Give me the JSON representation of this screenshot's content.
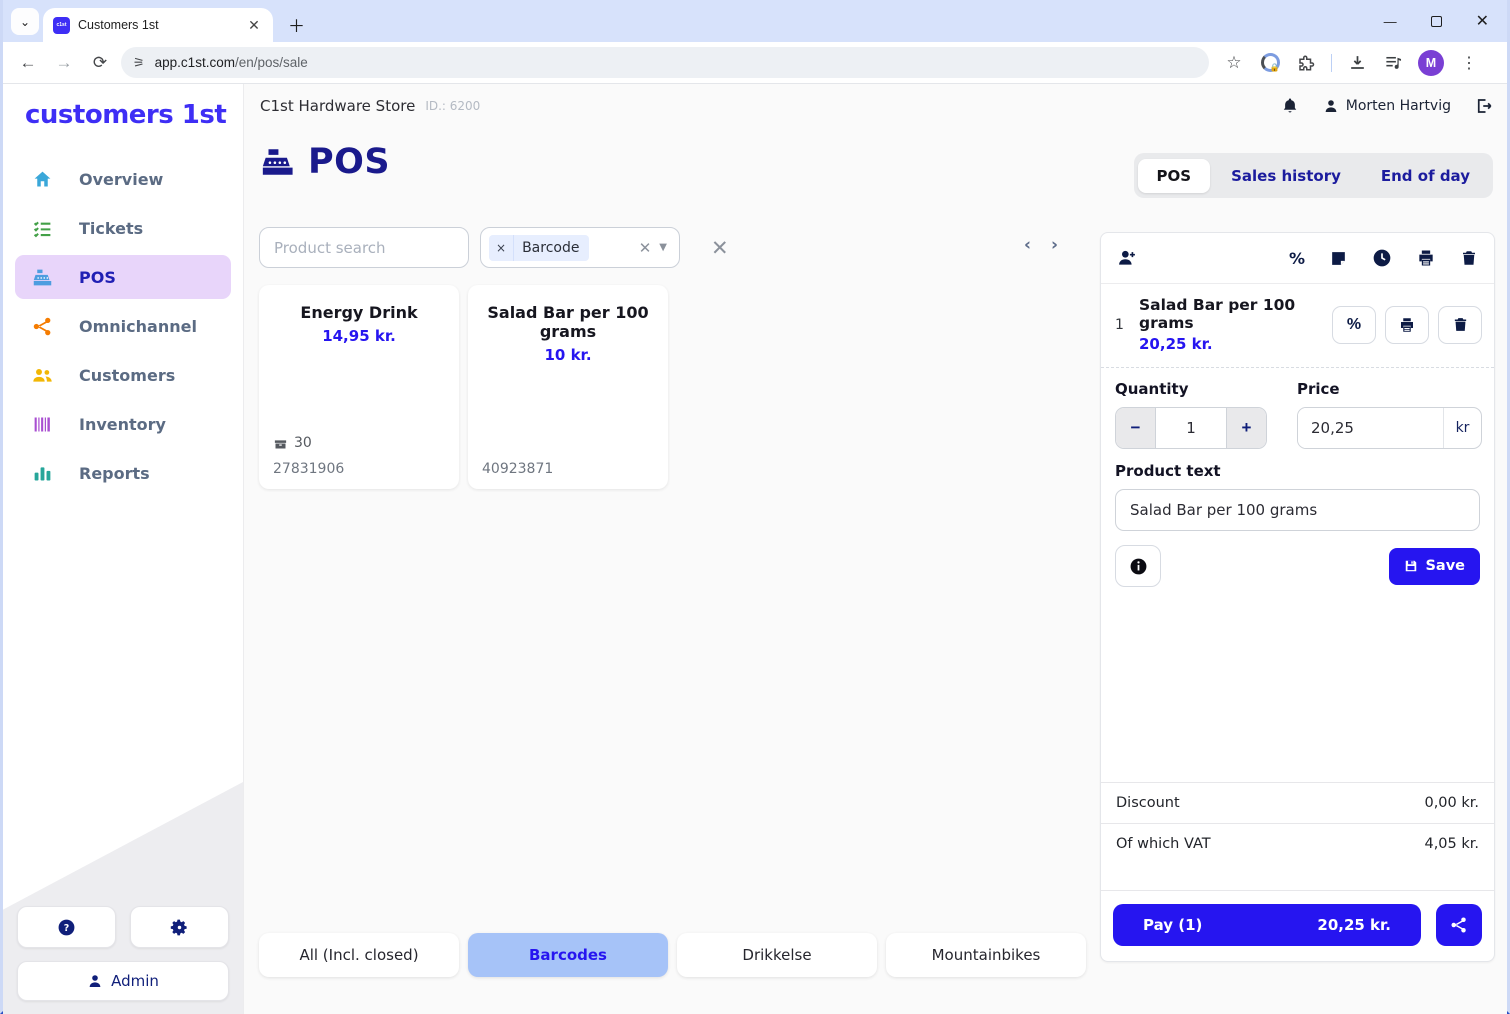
{
  "colors": {
    "accent": "#2615f0",
    "logo_blue": "#3e2ef5",
    "navy": "#1a1a8c",
    "nav_active_bg": "#e8d5fa",
    "category_active_bg": "#a6c3f8",
    "avatar_purple": "#7a3fd4"
  },
  "browser": {
    "tab_title": "Customers 1st",
    "favicon_text": "c1st",
    "url_domain": "app.c1st.com",
    "url_path": "/en/pos/sale",
    "avatar_letter": "M"
  },
  "sidebar": {
    "logo": "customers 1st",
    "items": [
      {
        "label": "Overview"
      },
      {
        "label": "Tickets"
      },
      {
        "label": "POS"
      },
      {
        "label": "Omnichannel"
      },
      {
        "label": "Customers"
      },
      {
        "label": "Inventory"
      },
      {
        "label": "Reports"
      }
    ],
    "admin_label": "Admin"
  },
  "header": {
    "store_name": "C1st Hardware Store",
    "store_id": "ID.: 6200",
    "user_name": "Morten Hartvig"
  },
  "page": {
    "title": "POS",
    "tabs": [
      {
        "label": "POS"
      },
      {
        "label": "Sales history"
      },
      {
        "label": "End of day"
      }
    ]
  },
  "search": {
    "placeholder": "Product search",
    "filter_value": "Barcode"
  },
  "products": [
    {
      "name": "Energy Drink",
      "price": "14,95 kr.",
      "stock": "30",
      "barcode": "27831906"
    },
    {
      "name": "Salad Bar per 100 grams",
      "price": "10 kr.",
      "barcode": "40923871"
    }
  ],
  "categories": [
    {
      "label": "All (Incl. closed)"
    },
    {
      "label": "Barcodes"
    },
    {
      "label": "Drikkelse"
    },
    {
      "label": "Mountainbikes"
    }
  ],
  "cart": {
    "line": {
      "index": "1",
      "name": "Salad Bar per 100 grams",
      "price": "20,25 kr."
    },
    "quantity_label": "Quantity",
    "quantity_value": "1",
    "price_label": "Price",
    "price_value": "20,25",
    "price_unit": "kr",
    "product_text_label": "Product text",
    "product_text_value": "Salad Bar per 100 grams",
    "save_label": "Save",
    "discount_label": "Discount",
    "discount_value": "0,00 kr.",
    "vat_label": "Of which VAT",
    "vat_value": "4,05 kr.",
    "pay_label": "Pay (1)",
    "pay_amount": "20,25 kr."
  }
}
